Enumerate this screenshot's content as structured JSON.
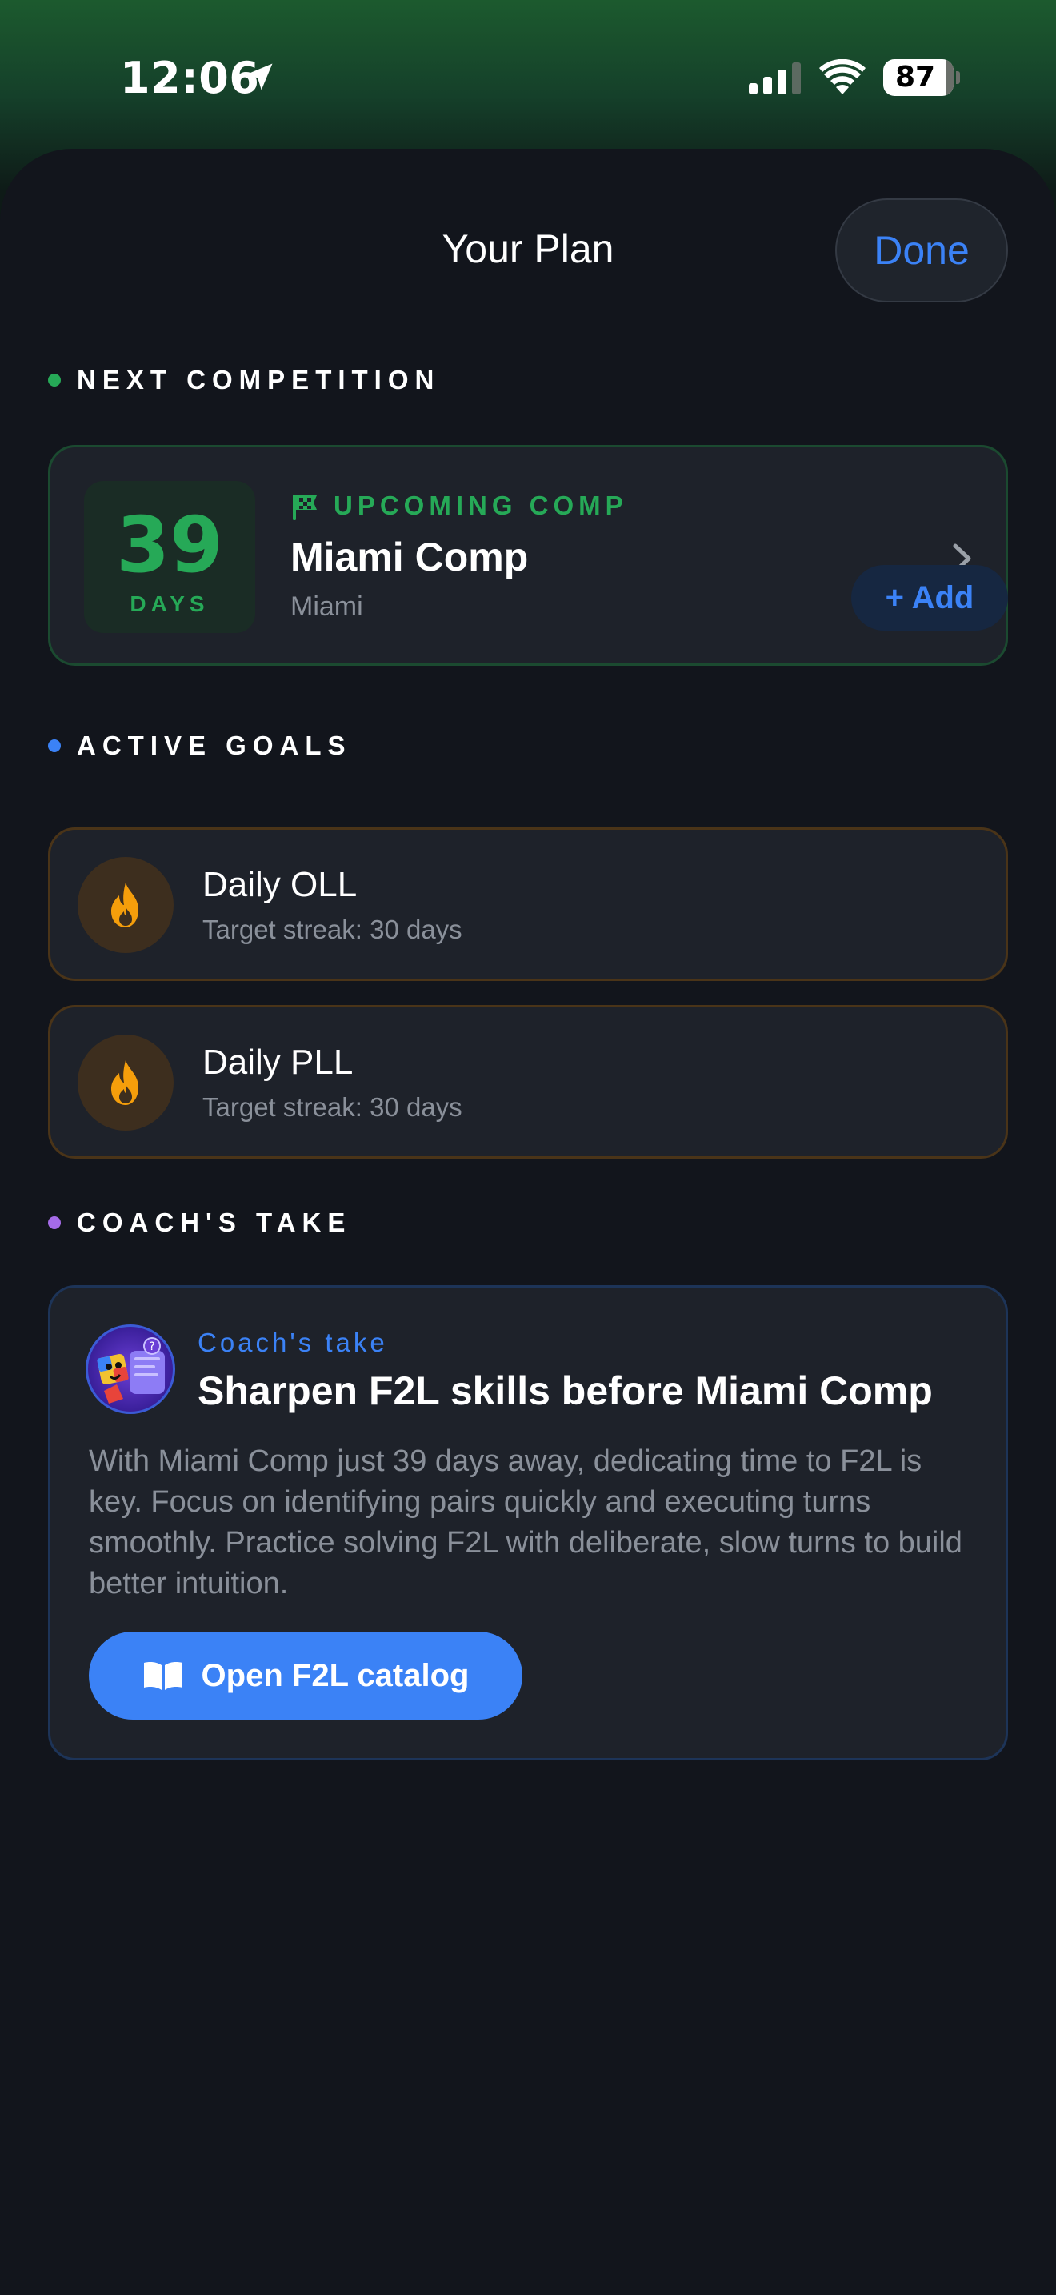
{
  "status_bar": {
    "time": "12:06",
    "battery": "87"
  },
  "sheet": {
    "title": "Your Plan",
    "done_label": "Done"
  },
  "next_competition": {
    "section_label": "NEXT COMPETITION",
    "days_count": "39",
    "days_label": "DAYS",
    "kicker": "UPCOMING COMP",
    "name": "Miami Comp",
    "location": "Miami"
  },
  "active_goals": {
    "section_label": "ACTIVE GOALS",
    "add_label": "+ Add",
    "items": [
      {
        "title": "Daily OLL",
        "subtitle": "Target streak: 30 days"
      },
      {
        "title": "Daily PLL",
        "subtitle": "Target streak: 30 days"
      }
    ]
  },
  "coach": {
    "section_label": "COACH'S TAKE",
    "kicker": "Coach's take",
    "title": "Sharpen F2L skills before Miami Comp",
    "body": "With Miami Comp just 39 days away, dedicating time to F2L is key. Focus on identifying pairs quickly and executing turns smoothly. Practice solving F2L with deliberate, slow turns to build better intuition.",
    "button_label": "Open F2L catalog"
  },
  "colors": {
    "accent_blue": "#3b82f6",
    "accent_green": "#26a957",
    "accent_orange": "#f59e0b",
    "accent_purple": "#a56be8"
  }
}
